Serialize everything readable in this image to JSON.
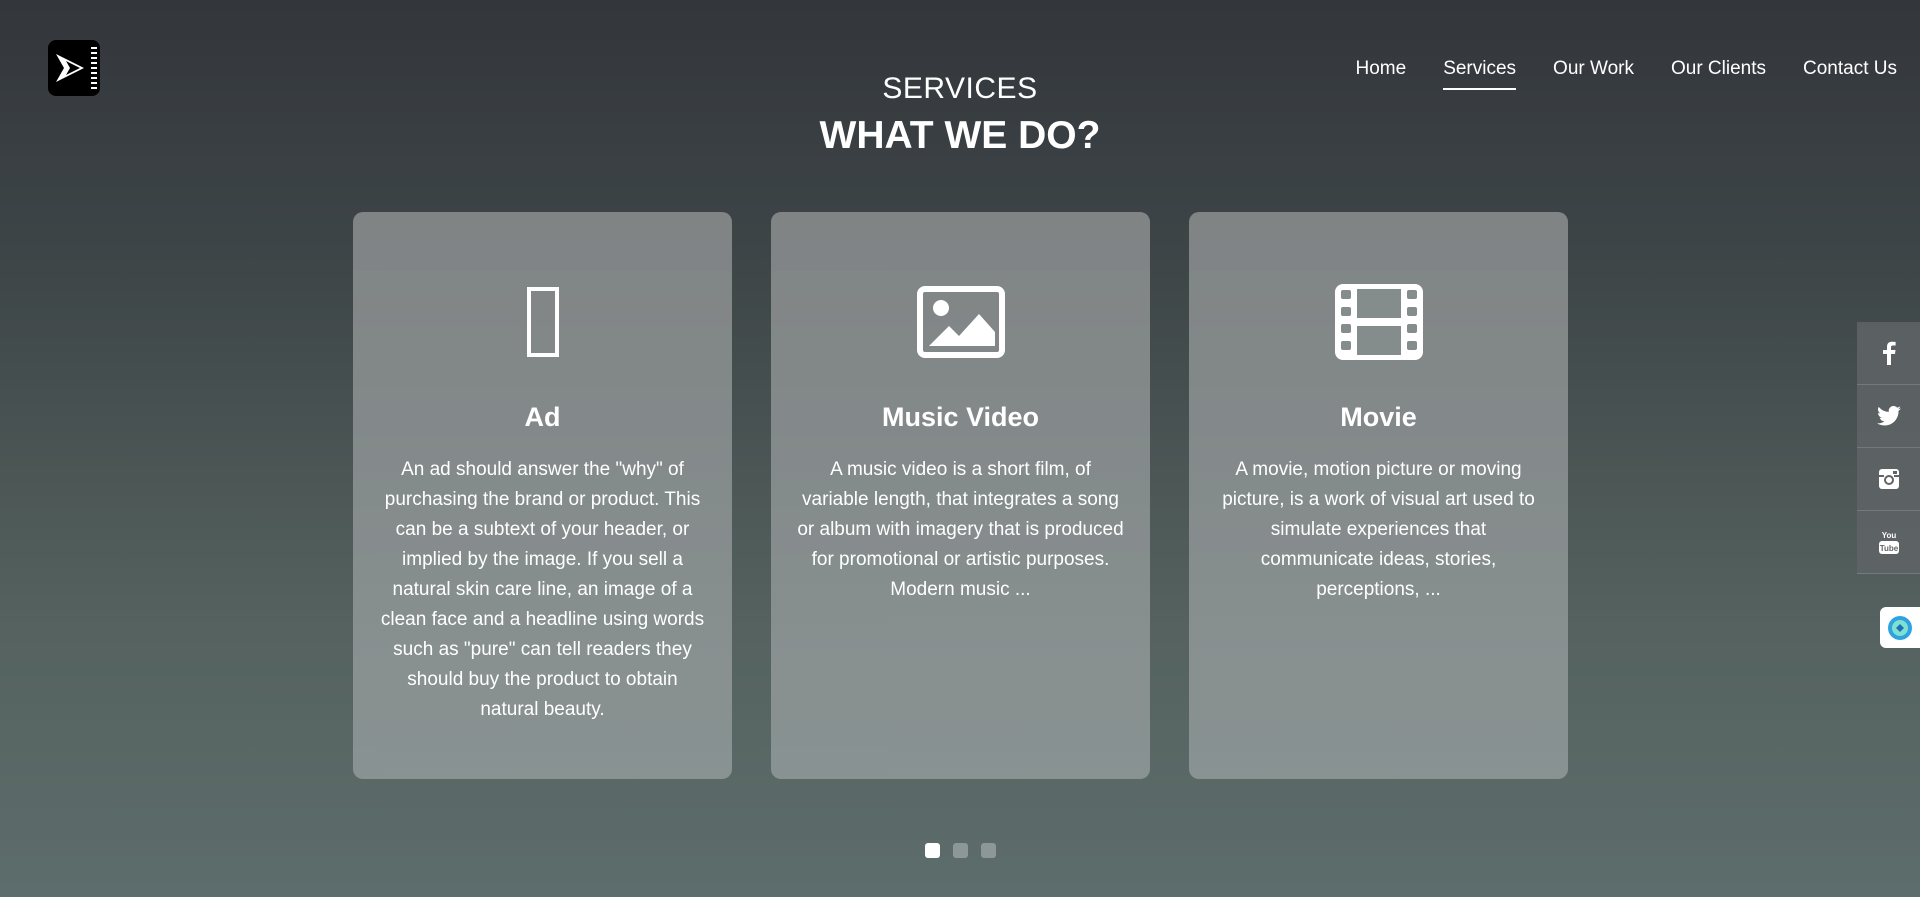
{
  "header": {
    "logo_icon": "play-arrow-film-icon",
    "nav": [
      {
        "label": "Home",
        "active": false
      },
      {
        "label": "Services",
        "active": true
      },
      {
        "label": "Our Work",
        "active": false
      },
      {
        "label": "Our Clients",
        "active": false
      },
      {
        "label": "Contact Us",
        "active": false
      }
    ]
  },
  "section": {
    "subtitle": "SERVICES",
    "title": "WHAT WE DO?"
  },
  "cards": [
    {
      "icon": "missing-glyph-icon",
      "glyph": "▯",
      "title": "Ad",
      "text": "An ad should answer the \"why\" of purchasing the brand or product. This can be a subtext of your header, or implied by the image. If you sell a natural skin care line, an image of a clean face and a headline using words such as \"pure\" can tell readers they should buy the product to obtain natural beauty."
    },
    {
      "icon": "image-icon",
      "title": "Music Video",
      "text": "A music video is a short film, of variable length, that integrates a song or album with imagery that is produced for promotional or artistic purposes. Modern music ..."
    },
    {
      "icon": "film-icon",
      "title": "Movie",
      "text": "A movie, motion picture or moving picture, is a work of visual art used to simulate experiences that communicate ideas, stories, perceptions, ..."
    }
  ],
  "carousel": {
    "pages": 3,
    "active_index": 0
  },
  "social": [
    "facebook-icon",
    "twitter-icon",
    "instagram-icon",
    "youtube-icon"
  ],
  "chat_widget_icon": "chat-bubble-icon"
}
